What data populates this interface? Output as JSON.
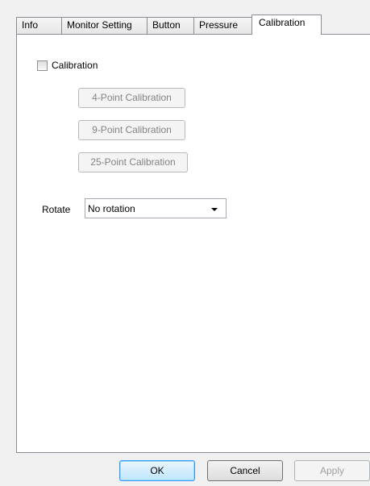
{
  "tabs": [
    {
      "label": "Info"
    },
    {
      "label": "Monitor Setting"
    },
    {
      "label": "Button"
    },
    {
      "label": "Pressure"
    },
    {
      "label": "Calibration"
    }
  ],
  "active_tab": "Calibration",
  "calibration": {
    "checkbox_label": "Calibration",
    "checked": false,
    "buttons": [
      {
        "label": "4-Point Calibration"
      },
      {
        "label": "9-Point Calibration"
      },
      {
        "label": "25-Point Calibration"
      }
    ]
  },
  "rotate": {
    "label": "Rotate",
    "value": "No rotation"
  },
  "footer": {
    "ok_label": "OK",
    "cancel_label": "Cancel",
    "apply_label": "Apply"
  }
}
